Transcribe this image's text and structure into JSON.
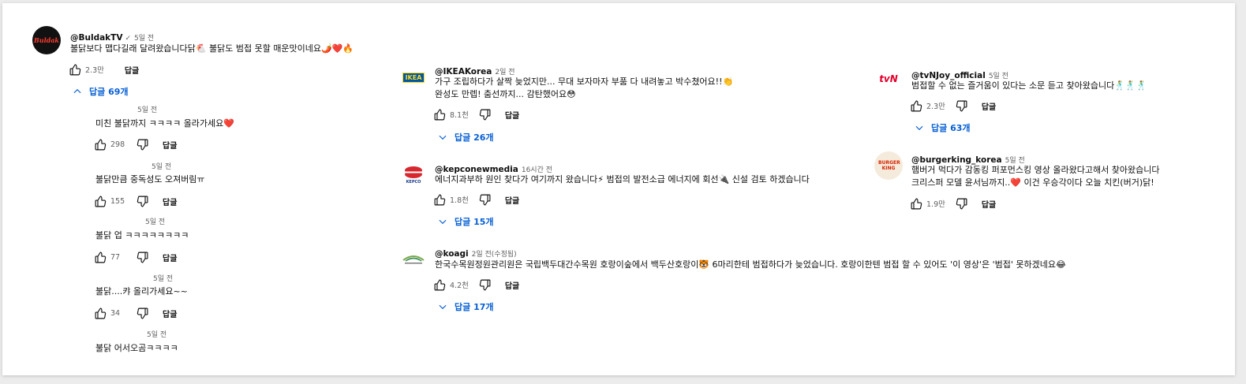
{
  "common": {
    "reply_label": "답글"
  },
  "comments": {
    "buldak": {
      "handle": "@BuldakTV",
      "time": "5일 전",
      "text": "불닭보다 맵다길래 달려왔습니다닭🐔 불닭도 범접 못할 매운맛이네요🌶️❤️🔥",
      "likes": "2.3만",
      "replies": "답글 69개",
      "avatar_text": "Buldak"
    },
    "ikea": {
      "handle": "@IKEAKorea",
      "time": "2일 전",
      "line1": "가구 조립하다가 살짝 늦었지만... 무대 보자마자 부품 다 내려놓고 박수쳤어요!!👏",
      "line2": "완성도 만렙! 춤선까지... 감탄했어요😳",
      "likes": "8.1천",
      "replies": "답글 26개",
      "avatar_text": "IKEA"
    },
    "kepco": {
      "handle": "@kepconewmedia",
      "time": "16시간 전",
      "text": "에너지과부하 원인 찾다가 여기까지 왔습니다⚡ 범접의 발전소급 에너지에 회선🔌 신설 검토 하겠습니다",
      "likes": "1.8천",
      "replies": "답글 15개",
      "avatar_text": "KEPCO"
    },
    "koagi": {
      "handle": "@koagi",
      "time": "2일 전(수정됨)",
      "text": "한국수목원정원관리원은 국립백두대간수목원 호랑이숲에서 백두산호랑이🐯 6마리한테 범접하다가 늦었습니다. 호랑이한텐 범접 할 수 있어도 '이 영상'은 '범접' 못하겠네요😂",
      "likes": "4.2천",
      "replies": "답글 17개"
    },
    "tvn": {
      "handle": "@tvNJoy_official",
      "time": "5일 전",
      "text": "범접할 수 없는 즐거움이 있다는 소문 듣고 찾아왔습니다🕺🕺🕺",
      "likes": "2.3만",
      "replies": "답글 63개",
      "avatar_text": "tvN"
    },
    "burger": {
      "handle": "@burgerking_korea",
      "time": "5일 전",
      "line1": "햄버거 먹다가 감동킹 퍼포먼스킹 영상 올라왔다고해서 찾아왔습니다",
      "line2": "크리스퍼 모델 윤서님까지..❤️ 이건 우승각이다 오늘 치킨(버거)닭!",
      "likes": "1.9만",
      "avatar_text": "BURGER KING"
    }
  },
  "replies": [
    {
      "time": "5일 전",
      "text": "미친 불닭까지 ㅋㅋㅋㅋ 올라가세요❤️",
      "likes": "298"
    },
    {
      "time": "5일 전",
      "text": "불닭만큼 중독성도 오져버림ㅠ",
      "likes": "155"
    },
    {
      "time": "5일 전",
      "text": "불닭 업 ㅋㅋㅋㅋㅋㅋㅋㅋ",
      "likes": "77"
    },
    {
      "time": "5일 전",
      "text": "불닭....캬 올리가세요~~",
      "likes": "34"
    },
    {
      "time": "5일 전",
      "text": "불닭 어서오곰ㅋㅋㅋㅋ"
    }
  ],
  "colors": {
    "link": "#065fd4",
    "buldak": "#c8102e",
    "tvn": "#e4002b",
    "kepco": "#d7282f",
    "ikea_blue": "#0058a3",
    "ikea_yellow": "#ffda1a"
  }
}
